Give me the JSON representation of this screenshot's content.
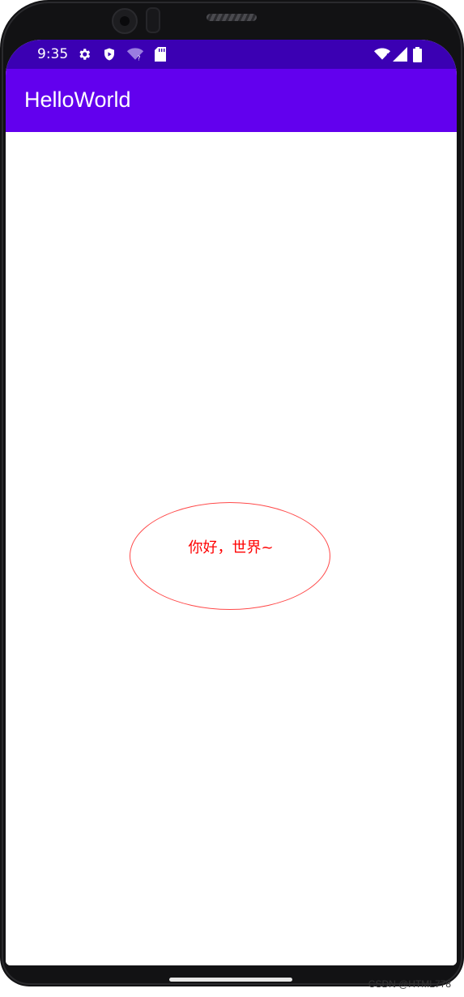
{
  "status_bar": {
    "time": "9:35",
    "left_icons": [
      "gear-icon",
      "shield-play-icon",
      "wifi-question-icon",
      "sd-card-icon"
    ],
    "right_icons": [
      "wifi-icon",
      "signal-icon",
      "battery-icon"
    ]
  },
  "app_bar": {
    "title": "HelloWorld"
  },
  "content": {
    "greeting": "你好，世界~"
  },
  "colors": {
    "status_bar": "#3b00b3",
    "app_bar": "#6200ee",
    "oval_stroke": "#ff4a4a",
    "greeting_text": "#ff0000"
  },
  "watermark": "CSDN @HTML778"
}
